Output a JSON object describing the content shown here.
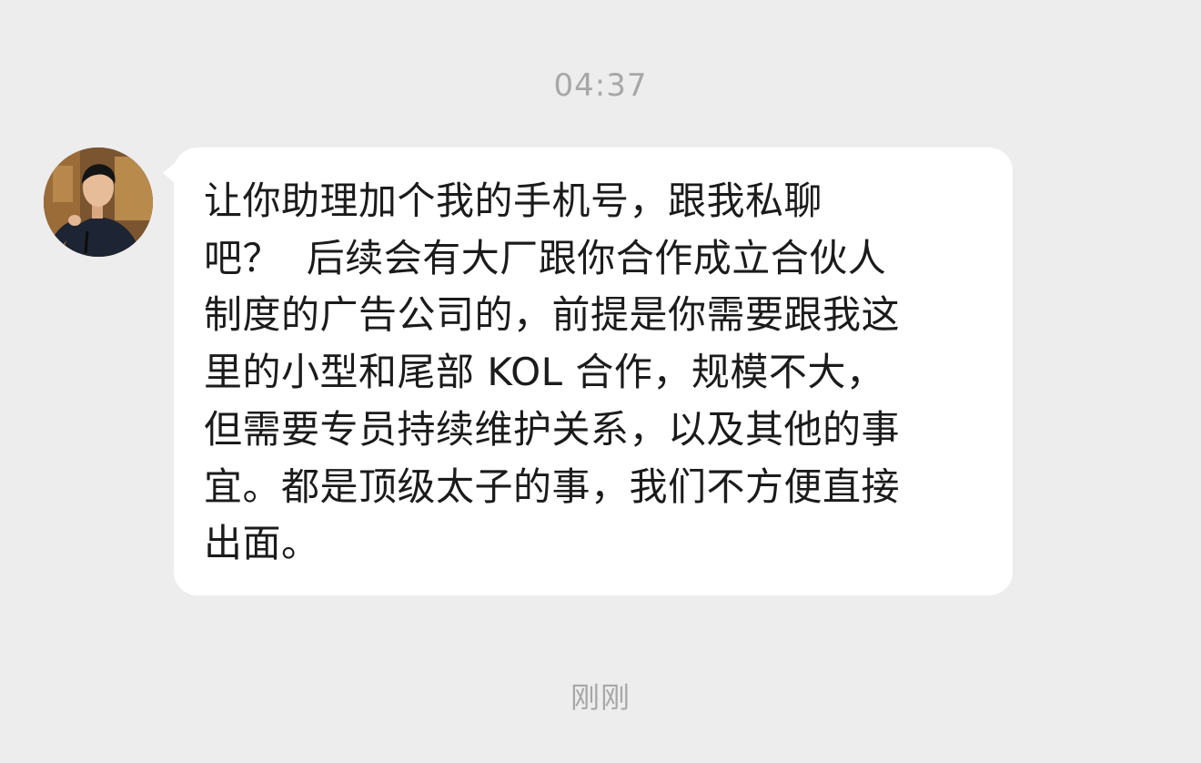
{
  "chat": {
    "timestamp_top": "04:37",
    "timestamp_bottom": "刚刚",
    "message": {
      "lines": [
        "让你助理加个我的手机号，跟我私聊",
        "吧？  后续会有大厂跟你合作成立合伙人",
        "制度的广告公司的，前提是你需要跟我这",
        "里的小型和尾部 KOL 合作，规模不大，",
        "但需要专员持续维护关系，以及其他的事",
        "宜。都是顶级太子的事，我们不方便直接",
        "出面。"
      ]
    },
    "bubble_color": "#ffffff",
    "background_color": "#ededed"
  }
}
